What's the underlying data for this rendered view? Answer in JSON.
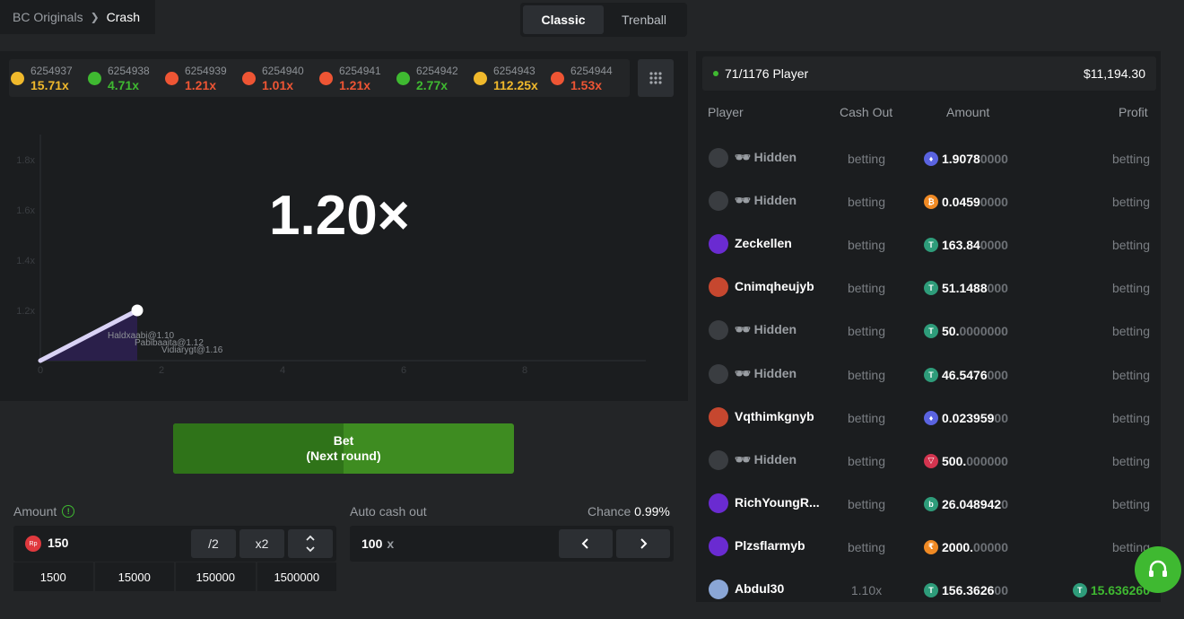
{
  "breadcrumb": {
    "parent": "BC Originals",
    "current": "Crash"
  },
  "modes": [
    {
      "label": "Classic",
      "active": true
    },
    {
      "label": "Trenball",
      "active": false
    }
  ],
  "history": [
    {
      "id": "6254937",
      "multiplier": "15.71x",
      "color": "#f0b92c"
    },
    {
      "id": "6254938",
      "multiplier": "4.71x",
      "color": "#3fb931"
    },
    {
      "id": "6254939",
      "multiplier": "1.21x",
      "color": "#ee5534"
    },
    {
      "id": "6254940",
      "multiplier": "1.01x",
      "color": "#ee5534"
    },
    {
      "id": "6254941",
      "multiplier": "1.21x",
      "color": "#ee5534"
    },
    {
      "id": "6254942",
      "multiplier": "2.77x",
      "color": "#3fb931"
    },
    {
      "id": "6254943",
      "multiplier": "112.25x",
      "color": "#f0b92c"
    },
    {
      "id": "6254944",
      "multiplier": "1.53x",
      "color": "#ee5534"
    }
  ],
  "game": {
    "current_multiplier": "1.20×",
    "overlap_labels": [
      "Vidiarygt@1.16",
      "Pabibaaita@1.12",
      "Haldxaabi@1.10"
    ]
  },
  "chart_data": {
    "type": "line",
    "x_ticks": [
      "0",
      "2",
      "4",
      "6",
      "8"
    ],
    "y_ticks": [
      "1.2x",
      "1.4x",
      "1.6x",
      "1.8x"
    ],
    "x": [
      0,
      1.6
    ],
    "y": [
      1.0,
      1.2
    ],
    "xlim": [
      0,
      10
    ],
    "ylim": [
      1.0,
      1.9
    ]
  },
  "bet": {
    "label_line1": "Bet",
    "label_line2": "(Next round)",
    "progress": 0.5
  },
  "amount": {
    "label": "Amount",
    "currency_icon": "Rp",
    "value": "150",
    "half": "/2",
    "double": "x2",
    "presets": [
      "1500",
      "15000",
      "150000",
      "1500000"
    ]
  },
  "auto_cashout": {
    "label": "Auto cash out",
    "value": "100",
    "unit": "x",
    "chance_label": "Chance",
    "chance_value": "0.99%"
  },
  "players": {
    "count": "71/1176 Player",
    "total": "$11,194.30",
    "headers": {
      "player": "Player",
      "cashout": "Cash Out",
      "amount": "Amount",
      "profit": "Profit"
    },
    "rows": [
      {
        "name": "Hidden",
        "hidden": true,
        "cashout": "betting",
        "amt_main": "1.9078",
        "amt_dim": "0000",
        "coin": "eth",
        "coin_color": "#5a63e0",
        "profit": "betting",
        "avatar": "#3a3d41"
      },
      {
        "name": "Hidden",
        "hidden": true,
        "cashout": "betting",
        "amt_main": "0.0459",
        "amt_dim": "0000",
        "coin": "btc",
        "coin_color": "#f08a24",
        "profit": "betting",
        "avatar": "#3a3d41"
      },
      {
        "name": "Zeckellen",
        "hidden": false,
        "cashout": "betting",
        "amt_main": "163.84",
        "amt_dim": "0000",
        "coin": "usdt",
        "coin_color": "#2e9c7a",
        "profit": "betting",
        "avatar": "#6a2bd1"
      },
      {
        "name": "Cnimqheujyb",
        "hidden": false,
        "cashout": "betting",
        "amt_main": "51.1488",
        "amt_dim": "000",
        "coin": "usdt",
        "coin_color": "#2e9c7a",
        "profit": "betting",
        "avatar": "#c6472f"
      },
      {
        "name": "Hidden",
        "hidden": true,
        "cashout": "betting",
        "amt_main": "50.",
        "amt_dim": "0000000",
        "coin": "usdt",
        "coin_color": "#2e9c7a",
        "profit": "betting",
        "avatar": "#3a3d41"
      },
      {
        "name": "Hidden",
        "hidden": true,
        "cashout": "betting",
        "amt_main": "46.5476",
        "amt_dim": "000",
        "coin": "usdt",
        "coin_color": "#2e9c7a",
        "profit": "betting",
        "avatar": "#3a3d41"
      },
      {
        "name": "Vqthimkgnyb",
        "hidden": false,
        "cashout": "betting",
        "amt_main": "0.023959",
        "amt_dim": "00",
        "coin": "eth",
        "coin_color": "#5a63e0",
        "profit": "betting",
        "avatar": "#c6472f"
      },
      {
        "name": "Hidden",
        "hidden": true,
        "cashout": "betting",
        "amt_main": "500.",
        "amt_dim": "000000",
        "coin": "trx",
        "coin_color": "#d3344f",
        "profit": "betting",
        "avatar": "#3a3d41"
      },
      {
        "name": "RichYoungR...",
        "hidden": false,
        "cashout": "betting",
        "amt_main": "26.048942",
        "amt_dim": "0",
        "coin": "bcd",
        "coin_color": "#2e9c7a",
        "profit": "betting",
        "avatar": "#6a2bd1"
      },
      {
        "name": "Plzsflarmyb",
        "hidden": false,
        "cashout": "betting",
        "amt_main": "2000.",
        "amt_dim": "00000",
        "coin": "inr",
        "coin_color": "#f08a24",
        "profit": "betting",
        "avatar": "#6a2bd1"
      },
      {
        "name": "Abdul30",
        "hidden": false,
        "cashout": "1.10x",
        "amt_main": "156.3626",
        "amt_dim": "00",
        "coin": "usdt",
        "coin_color": "#2e9c7a",
        "profit": "15.636260",
        "profit_win": true,
        "avatar": "#8aa6d6"
      }
    ]
  }
}
